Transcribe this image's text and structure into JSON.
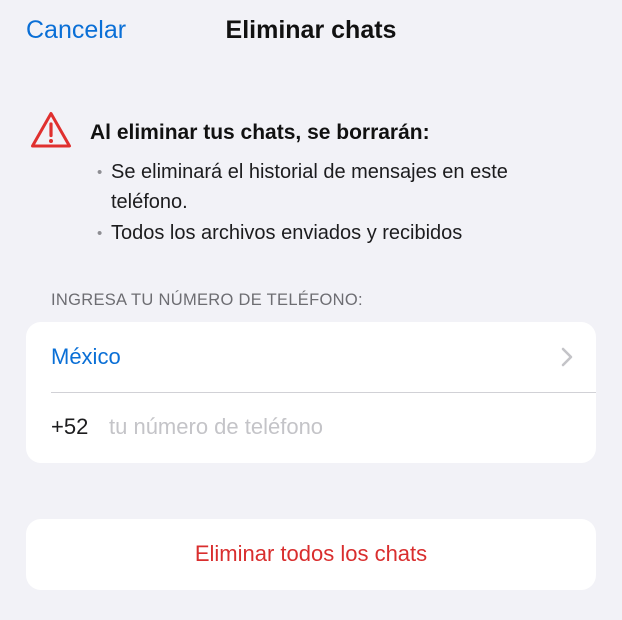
{
  "nav": {
    "cancel_label": "Cancelar",
    "title": "Eliminar chats"
  },
  "warning": {
    "icon": "warning-triangle-icon",
    "heading": "Al eliminar tus chats, se borrarán:",
    "bullets": [
      "Se eliminará el historial de mensajes en este teléfono.",
      "Todos los archivos enviados y recibidos"
    ]
  },
  "phone_section": {
    "label": "INGRESA TU NÚMERO DE TELÉFONO:",
    "country": "México",
    "country_code": "+52",
    "number_value": "",
    "number_placeholder": "tu número de teléfono"
  },
  "actions": {
    "delete_all_label": "Eliminar todos los chats"
  },
  "colors": {
    "accent_blue": "#0a6fd6",
    "destructive_red": "#d92e2e",
    "background": "#f2f2f7",
    "card": "#ffffff"
  }
}
